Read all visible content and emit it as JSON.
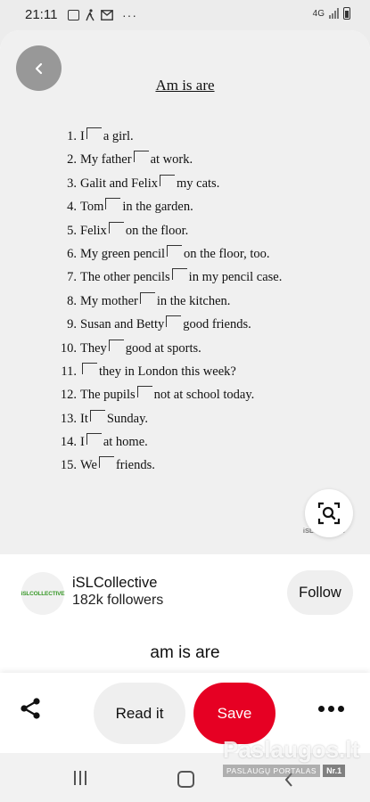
{
  "status_bar": {
    "time": "21:11",
    "network": "4G"
  },
  "worksheet": {
    "title": "Am is are",
    "watermark": "iSLCollective",
    "items": [
      {
        "num": "1.",
        "before": "I",
        "after": "a girl."
      },
      {
        "num": "2.",
        "before": "My father",
        "after": "at work."
      },
      {
        "num": "3.",
        "before": "Galit and Felix",
        "after": "my cats."
      },
      {
        "num": "4.",
        "before": "Tom",
        "after": "in the garden."
      },
      {
        "num": "5.",
        "before": "Felix",
        "after": "on the floor."
      },
      {
        "num": "6.",
        "before": "My green pencil",
        "after": "on the floor, too."
      },
      {
        "num": "7.",
        "before": "The other pencils",
        "after": "in my pencil case."
      },
      {
        "num": "8.",
        "before": "My mother",
        "after": "in the kitchen."
      },
      {
        "num": "9.",
        "before": "Susan and Betty",
        "after": "good friends."
      },
      {
        "num": "10.",
        "before": "They",
        "after": "good at sports."
      },
      {
        "num": "11.",
        "before": "",
        "after": "they in London this week?"
      },
      {
        "num": "12.",
        "before": "The pupils",
        "after": "not at school today."
      },
      {
        "num": "13.",
        "before": "It",
        "after": "Sunday."
      },
      {
        "num": "14.",
        "before": "I",
        "after": "at home."
      },
      {
        "num": "15.",
        "before": "We",
        "after": "friends."
      }
    ]
  },
  "account": {
    "avatar_text": "iSLCOLLECTIVE",
    "name": "iSLCollective",
    "followers": "182k followers",
    "follow_label": "Follow"
  },
  "pin_title": "am is are",
  "actions": {
    "read_label": "Read it",
    "save_label": "Save"
  },
  "promo": {
    "brand": "Paslaugos.lt",
    "tagline": "PASLAUGŲ PORTALAS",
    "badge": "Nr.1"
  },
  "colors": {
    "save": "#e60023",
    "avatar_text": "#3a9a2a"
  }
}
